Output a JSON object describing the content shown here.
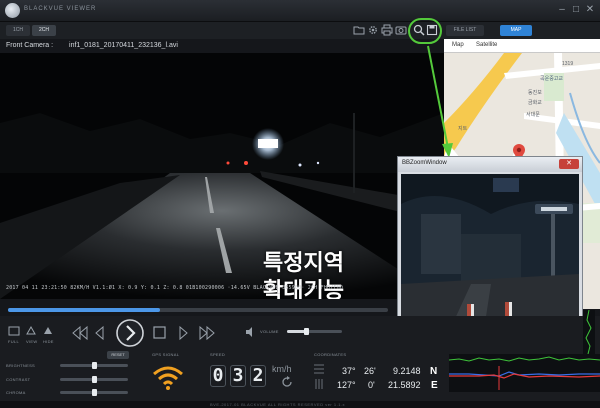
{
  "app": {
    "title": "BLACKVUE VIEWER"
  },
  "channels": [
    {
      "label": "1CH"
    },
    {
      "label": "2CH"
    }
  ],
  "tabs": {
    "file_list": "FILE LIST",
    "map": "MAP"
  },
  "camera": {
    "label": "Front Camera :",
    "filename": "inf1_0181_20170411_232136_l.avi"
  },
  "osd_text": "2017 04 11 23:21:50  82KM/H V1.1:Ø1  X: 0.9 Y: 0.1 Z: 0.8 01B100290006 ·14.65V BLACKVUE  365900· 2CH FHD/FHD",
  "overlay_text": {
    "line1": "특정지역",
    "line2": "확대기능"
  },
  "map": {
    "tab_map": "Map",
    "tab_satellite": "Satellite",
    "labels": [
      "1319",
      "곡운중고교",
      "동진보",
      "금화교",
      "서대문",
      "지트"
    ]
  },
  "zoom_window": {
    "title": "BBZoomWindow"
  },
  "progress": {
    "value": 0.4
  },
  "controls": {
    "labels": [
      "FULL",
      "VIEW",
      "HIDE"
    ],
    "volume_label": "VOLUME",
    "volume_value": 0.35
  },
  "adjust": {
    "reset_label": "RESET",
    "items": [
      {
        "label": "BRIGHTNESS",
        "value": 0.5
      },
      {
        "label": "CONTRAST",
        "value": 0.5
      },
      {
        "label": "CHROMA",
        "value": 0.5
      }
    ]
  },
  "gps": {
    "label": "GPS SIGNAL"
  },
  "speed": {
    "label": "SPEED",
    "digits": [
      "0",
      "3",
      "2"
    ],
    "unit": "km/h"
  },
  "coordinates": {
    "label": "COORDINATES",
    "lat": {
      "deg": "37°",
      "min": "26'",
      "sec": "9.2148",
      "dir": "N"
    },
    "lon": {
      "deg": "127°",
      "min": "0'",
      "sec": "21.5892",
      "dir": "E"
    }
  },
  "footer": "BVE-2017-01 BLACKVUE ALL RIGHTS RESERVED ver 1.1.x",
  "colors": {
    "accent": "#2f83d6",
    "highlight": "#54c93b",
    "gps": "#f0a020"
  }
}
